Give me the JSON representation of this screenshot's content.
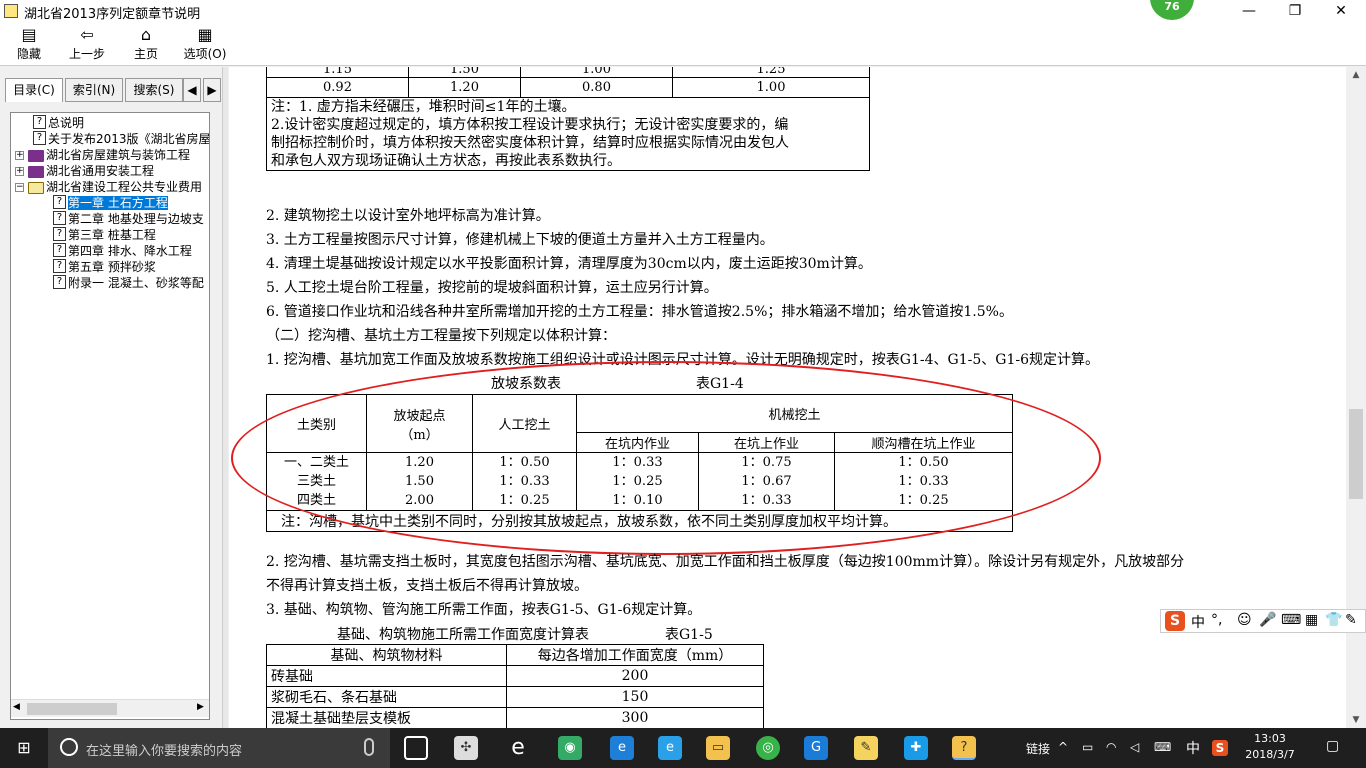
{
  "window": {
    "title": "湖北省2013序列定额章节说明",
    "badge": "76",
    "minimize": "—",
    "restore": "❐",
    "close": "✕"
  },
  "toolbar": {
    "hide": "隐藏",
    "back": "上一步",
    "home": "主页",
    "options": "选项(O)"
  },
  "tabs": {
    "toc": "目录(C)",
    "index": "索引(N)",
    "search": "搜索(S)"
  },
  "tree": [
    {
      "label": "总说明",
      "kind": "page",
      "level": 1
    },
    {
      "label": "关于发布2013版《湖北省房屋",
      "kind": "page",
      "level": 1
    },
    {
      "label": "湖北省房屋建筑与装饰工程",
      "kind": "book",
      "level": 0
    },
    {
      "label": "湖北省通用安装工程",
      "kind": "book",
      "level": 0
    },
    {
      "label": "湖北省建设工程公共专业费用",
      "kind": "bookopen",
      "level": 0
    },
    {
      "label": "第一章 土石方工程",
      "kind": "page",
      "level": 2
    },
    {
      "label": "第二章 地基处理与边坡支",
      "kind": "page",
      "level": 2
    },
    {
      "label": "第三章 桩基工程",
      "kind": "page",
      "level": 2
    },
    {
      "label": "第四章 排水、降水工程",
      "kind": "page",
      "level": 2
    },
    {
      "label": "第五章 预拌砂浆",
      "kind": "page",
      "level": 2
    },
    {
      "label": "附录一 混凝土、砂浆等配",
      "kind": "page",
      "level": 2
    }
  ],
  "content": {
    "top_table": {
      "row_partial": [
        "1.15",
        "1.50",
        "1.00",
        "1.25"
      ],
      "row": [
        "0.92",
        "1.20",
        "0.80",
        "1.00"
      ],
      "note1": "注：1. 虚方指未经碾压，堆积时间≤1年的土壤。",
      "note2": "2.设计密实度超过规定的，填方体积按工程设计要求执行；无设计密实度要求的，编",
      "note3": "制招标控制价时，填方体积按天然密实度体积计算，结算时应根据实际情况由发包人",
      "note4": "和承包人双方现场证确认土方状态，再按此表系数执行。"
    },
    "paras": [
      "2. 建筑物挖土以设计室外地坪标高为准计算。",
      "3. 土方工程量按图示尺寸计算，修建机械上下坡的便道土方量并入土方工程量内。",
      "4. 清理土堤基础按设计规定以水平投影面积计算，清理厚度为30cm以内，废土运距按30m计算。",
      "5. 人工挖土堤台阶工程量，按挖前的堤坡斜面积计算，运土应另行计算。",
      "6. 管道接口作业坑和沿线各种井室所需增加开挖的土方工程量：排水管道按2.5%；排水箱涵不增加；给水管道按1.5%。",
      "（二）挖沟槽、基坑土方工程量按下列规定以体积计算：",
      "1. 挖沟槽、基坑加宽工作面及放坡系数按施工组织设计或设计图示尺寸计算。设计无明确规定时，按表G1-4、G1-5、G1-6规定计算。"
    ],
    "table_g14": {
      "caption": "放坡系数表",
      "code": "表G1-4",
      "h_soil": "土类别",
      "h_start": "放坡起点",
      "h_start_unit": "（m）",
      "h_manual": "人工挖土",
      "h_mech": "机械挖土",
      "h_in_pit": "在坑内作业",
      "h_on_pit": "在坑上作业",
      "h_along": "顺沟槽在坑上作业",
      "rows": [
        [
          "一、二类土",
          "1.20",
          "1：0.50",
          "1：0.33",
          "1：0.75",
          "1：0.50"
        ],
        [
          "三类土",
          "1.50",
          "1：0.33",
          "1：0.25",
          "1：0.67",
          "1：0.33"
        ],
        [
          "四类土",
          "2.00",
          "1：0.25",
          "1：0.10",
          "1：0.33",
          "1：0.25"
        ]
      ],
      "note": "注：沟槽，基坑中土类别不同时，分别按其放坡起点，放坡系数，依不同土类别厚度加权平均计算。"
    },
    "paras2": [
      "2. 挖沟槽、基坑需支挡土板时，其宽度包括图示沟槽、基坑底宽、加宽工作面和挡土板厚度（每边按100mm计算）。除设计另有规定外，凡放坡部分",
      "不得再计算支挡土板，支挡土板后不得再计算放坡。",
      "3. 基础、构筑物、管沟施工所需工作面，按表G1-5、G1-6规定计算。"
    ],
    "table_g15": {
      "caption": "基础、构筑物施工所需工作面宽度计算表",
      "code": "表G1-5",
      "h_material": "基础、构筑物材料",
      "h_width": "每边各增加工作面宽度（mm）",
      "rows": [
        [
          "砖基础",
          "200"
        ],
        [
          "浆砌毛石、条石基础",
          "150"
        ],
        [
          "混凝土基础垫层支模板",
          "300"
        ]
      ]
    }
  },
  "taskbar": {
    "search_placeholder": "在这里输入你要搜索的内容",
    "links": "链接",
    "ime_lang": "中",
    "time": "13:03",
    "date": "2018/3/7"
  },
  "ime_bar": {
    "lang": "中",
    "punct": "°,"
  },
  "colors": {
    "annotation": "#e02020",
    "selection": "#0078d7",
    "badge": "#3fae3a"
  }
}
